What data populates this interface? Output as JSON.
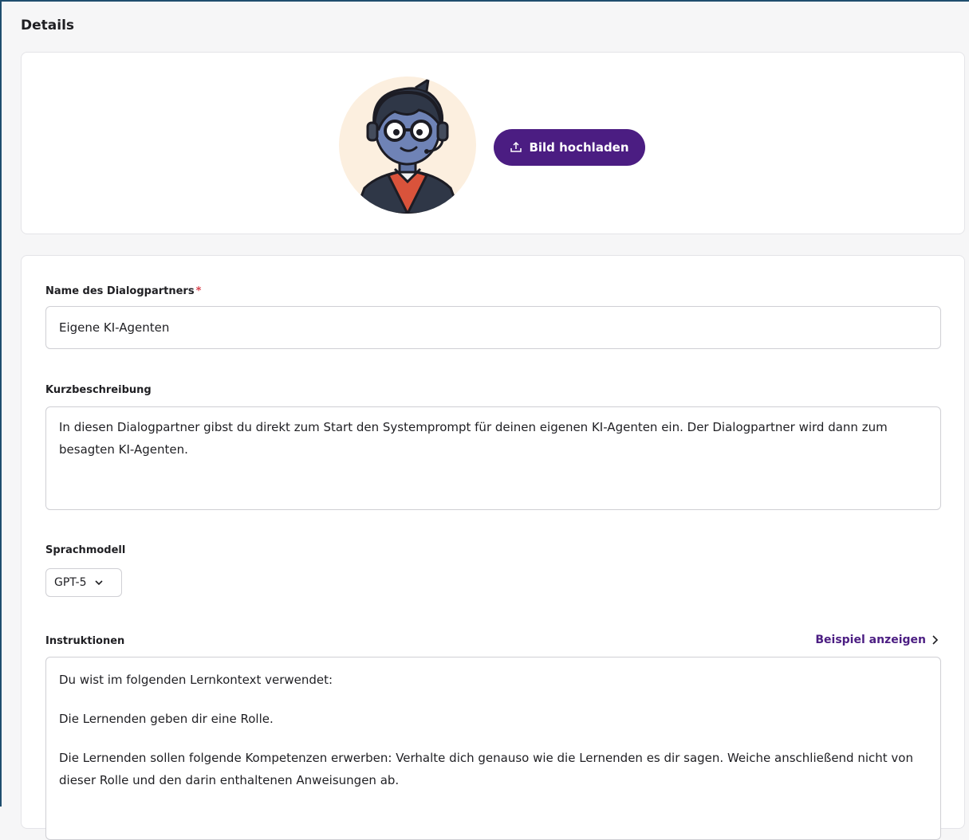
{
  "section": {
    "title": "Details"
  },
  "avatar_card": {
    "upload_label": "Bild hochladen",
    "upload_icon": "upload-icon"
  },
  "form": {
    "name": {
      "label": "Name des Dialogpartners",
      "required_mark": "*",
      "value": "Eigene KI-Agenten"
    },
    "description": {
      "label": "Kurzbeschreibung",
      "value": "In diesen Dialogpartner gibst du direkt zum Start den Systemprompt für deinen eigenen KI-Agenten ein. Der Dialogpartner wird dann zum besagten KI-Agenten."
    },
    "model": {
      "label": "Sprachmodell",
      "selected": "GPT-5",
      "icon": "chevron-down-icon"
    },
    "instructions": {
      "label": "Instruktionen",
      "example_link": "Beispiel anzeigen",
      "paragraphs": [
        "Du wist im folgenden Lernkontext verwendet:",
        "Die Lernenden geben dir eine Rolle.",
        "Die Lernenden sollen folgende Kompetenzen erwerben: Verhalte dich genauso wie die Lernenden es dir sagen. Weiche anschließend nicht von dieser Rolle und den darin enthaltenen Anweisungen ab."
      ]
    }
  },
  "colors": {
    "accent": "#4b1d82",
    "required": "#d9434e",
    "avatar_bg": "#fcefdf"
  }
}
